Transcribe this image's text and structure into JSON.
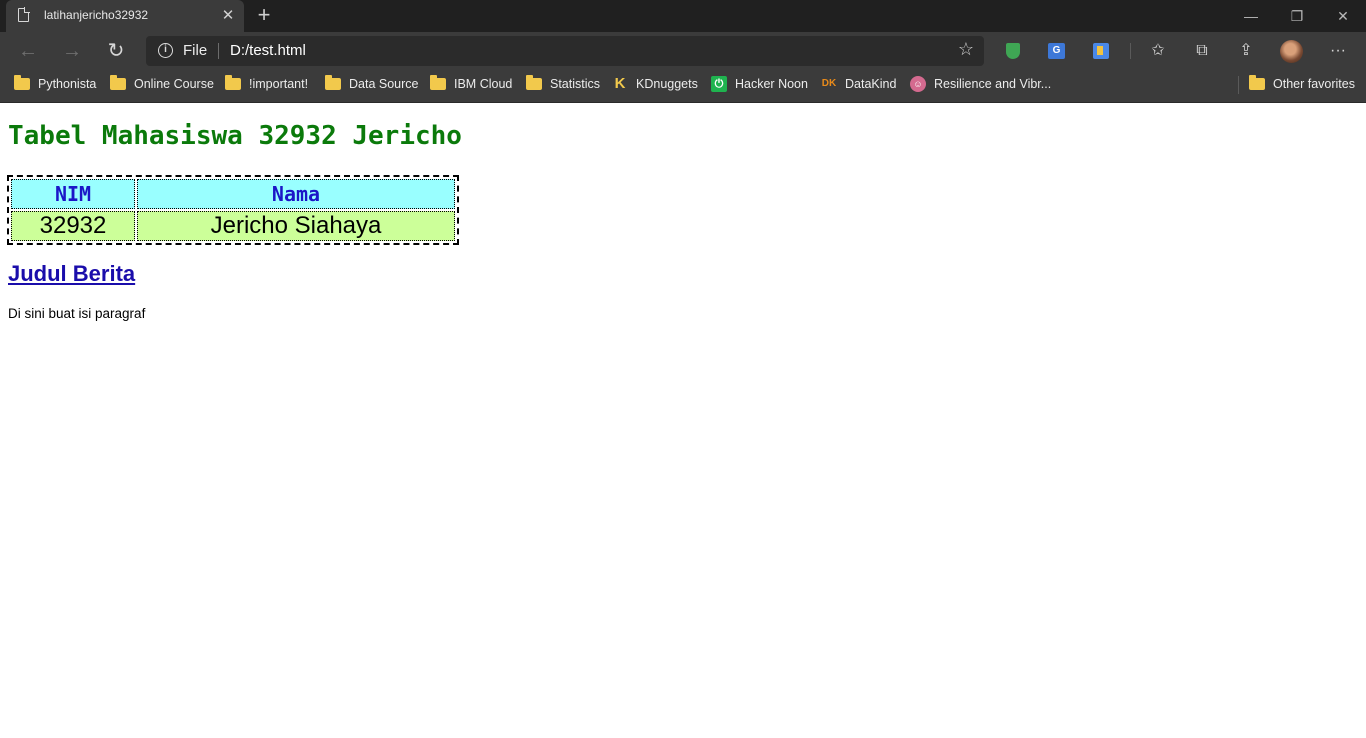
{
  "browser": {
    "tab": {
      "title": "latihanjericho32932",
      "close_icon": "close-icon"
    },
    "address_bar": {
      "scheme": "File",
      "url": "D:/test.html"
    },
    "bookmarks": [
      {
        "label": "Pythonista",
        "icon": "folder-icon"
      },
      {
        "label": "Online Course",
        "icon": "folder-icon"
      },
      {
        "label": "!important!",
        "icon": "folder-icon"
      },
      {
        "label": "Data Source",
        "icon": "folder-icon"
      },
      {
        "label": "IBM Cloud",
        "icon": "folder-icon"
      },
      {
        "label": "Statistics",
        "icon": "folder-icon"
      },
      {
        "label": "KDnuggets",
        "icon": "kdnuggets-icon"
      },
      {
        "label": "Hacker Noon",
        "icon": "hackernoon-icon"
      },
      {
        "label": "DataKind",
        "icon": "datakind-icon"
      },
      {
        "label": "Resilience and Vibr...",
        "icon": "resilience-icon"
      }
    ],
    "other_favorites": "Other favorites",
    "colors": {
      "chrome_dark": "#202020",
      "chrome": "#3b3b3b",
      "folder": "#f2c94c"
    }
  },
  "page": {
    "heading": "Tabel Mahasiswa 32932 Jericho",
    "table": {
      "headers": [
        "NIM",
        "Nama"
      ],
      "rows": [
        [
          "32932",
          "Jericho Siahaya"
        ]
      ]
    },
    "news_title": "Judul Berita",
    "paragraph": "Di sini buat isi paragraf",
    "colors": {
      "heading": "#0b7a0b",
      "th_bg": "#99ffff",
      "th_text": "#1b17c8",
      "td_bg": "#ccff99",
      "link": "#1a0dab"
    }
  }
}
